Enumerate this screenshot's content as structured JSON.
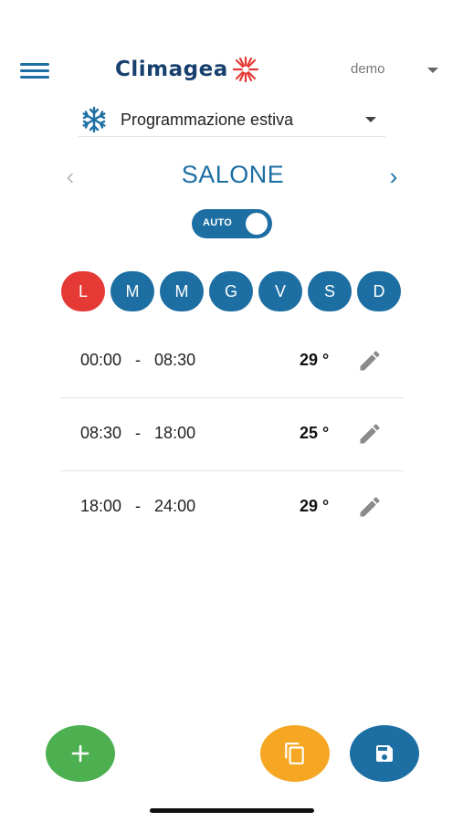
{
  "header": {
    "brand_name": "Climagea",
    "user_name": "demo",
    "brand_color": "#17406e",
    "sun_color": "#e53935"
  },
  "program": {
    "icon": "snowflake-icon",
    "label": "Programmazione estiva"
  },
  "room": {
    "name": "SALONE",
    "prev_icon": "chevron-left-icon",
    "next_icon": "chevron-right-icon"
  },
  "mode_toggle": {
    "label": "AUTO",
    "on": true
  },
  "days": [
    {
      "label": "L",
      "active": true
    },
    {
      "label": "M",
      "active": false
    },
    {
      "label": "M",
      "active": false
    },
    {
      "label": "G",
      "active": false
    },
    {
      "label": "V",
      "active": false
    },
    {
      "label": "S",
      "active": false
    },
    {
      "label": "D",
      "active": false
    }
  ],
  "schedule": [
    {
      "time": "00:00   -   08:30",
      "temp": "29 °"
    },
    {
      "time": "08:30   -   18:00",
      "temp": "25 °"
    },
    {
      "time": "18:00   -   24:00",
      "temp": "29 °"
    }
  ],
  "actions": {
    "add_icon": "plus-icon",
    "copy_icon": "copy-icon",
    "save_icon": "save-icon"
  },
  "colors": {
    "primary": "#1d6fa3",
    "active_day": "#e53935",
    "add": "#4caf50",
    "copy": "#f5a623"
  }
}
